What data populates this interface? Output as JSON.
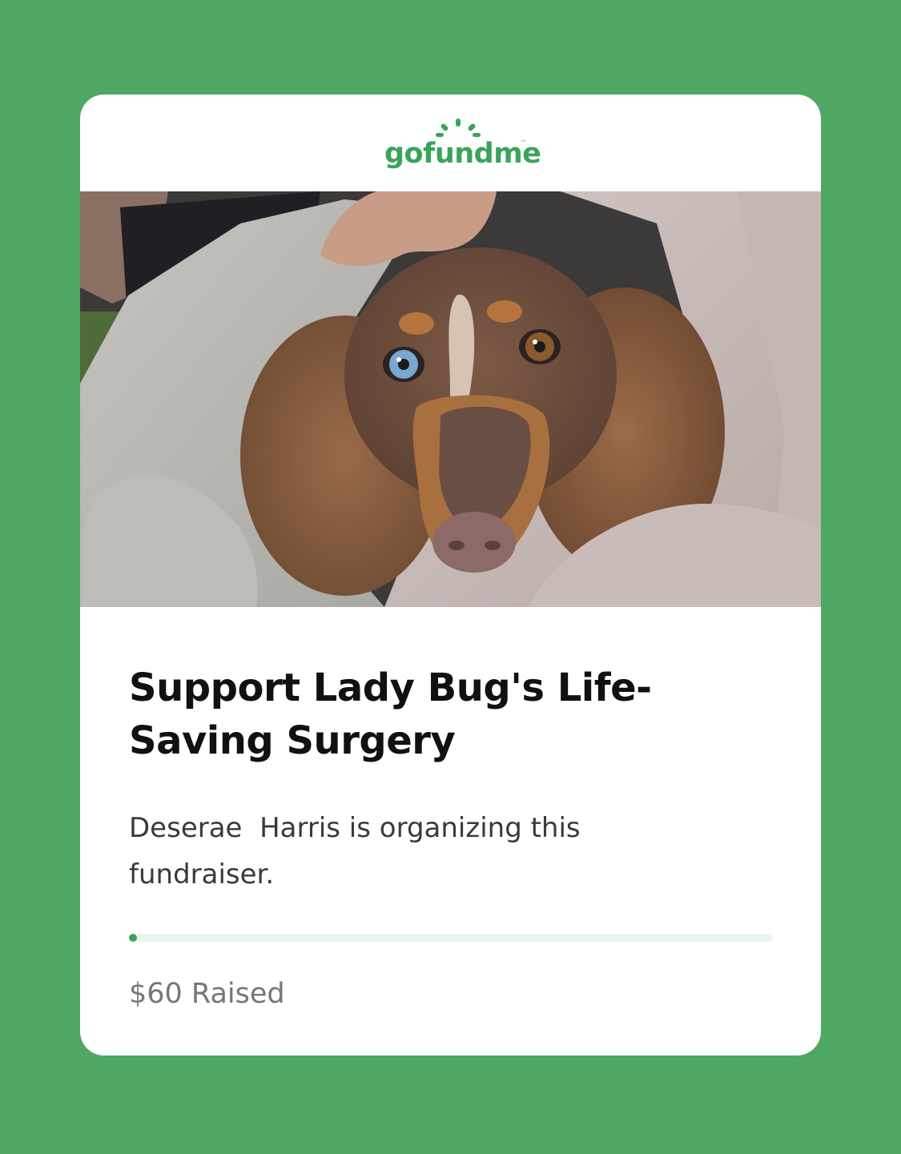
{
  "brand": {
    "logo_text": "gofundme",
    "logo_tm": "™",
    "accent_color": "#3aa35a"
  },
  "hero_image": {
    "subject": "dachshund-photo"
  },
  "fundraiser": {
    "title": "Support Lady Bug's Life-Saving Surgery",
    "organizer_text": "Deserae  Harris is organizing this fundraiser.",
    "progress_fraction": 0.0,
    "raised_label": "$60 Raised"
  },
  "colors": {
    "page_background": "#4ea864",
    "progress_track": "#e8f5ec",
    "progress_fill": "#3aa35a"
  }
}
